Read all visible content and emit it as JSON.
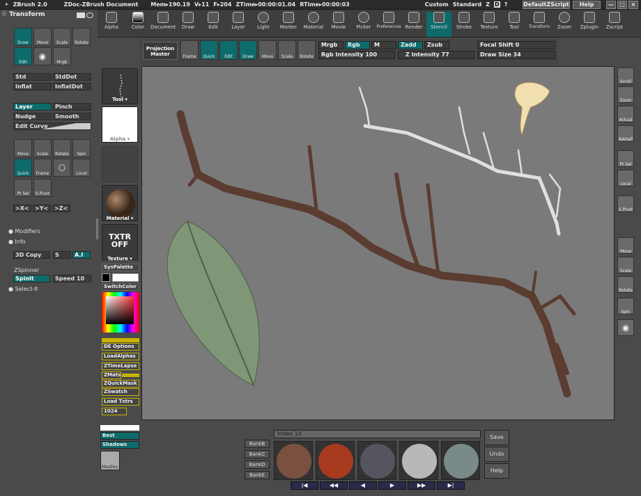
{
  "titlebar": {
    "app": "ZBrush 2.0",
    "doc": "ZDoc-ZBrush Document",
    "mem": "Mem▸190.19",
    "v": "V▸11",
    "f": "F▸204",
    "ztime": "ZTime▸00:00:01.04",
    "rtime": "RTime▸00:00:03",
    "custom": "Custom",
    "standard": "Standard",
    "z": "Z",
    "d": "D",
    "q": "?",
    "zscript": "DefaultZScript",
    "help": "Help"
  },
  "menu": [
    "Alpha",
    "Color",
    "Document",
    "Draw",
    "Edit",
    "Layer",
    "Light",
    "Marker",
    "Material",
    "Movie",
    "Picker",
    "Preferences",
    "Render",
    "Stencil",
    "Stroke",
    "Texture",
    "Tool",
    "Transform",
    "Zoom",
    "Zplugin",
    "Zscript"
  ],
  "left": {
    "title": "Transform",
    "icons1": [
      "Draw",
      "Move",
      "Scale",
      "Rotate"
    ],
    "icons2": [
      "Edit",
      "Snapshot",
      "Mrgb"
    ],
    "brushes": [
      "Std",
      "StdDot",
      "Inflat",
      "InflatDot"
    ],
    "brushes2": [
      "Layer",
      "Pinch",
      "Nudge",
      "Smooth"
    ],
    "editcurve": "Edit Curve",
    "deform": [
      "Move",
      "Scale",
      "Rotate",
      "Spin"
    ],
    "deform2": [
      "Quick",
      "Frame",
      "Solid",
      "Local"
    ],
    "deform3": [
      "Pt Sel",
      "S.Pivot"
    ],
    "axes": [
      ">X<",
      ">Y<",
      ">Z<"
    ],
    "modifiers": "Modifiers",
    "info": "Info",
    "copy3d": "3D Copy",
    "s": "S",
    "ai": "A.I",
    "zspinner": "ZSpinner",
    "spinit": "SpinIt",
    "speed": "Speed",
    "speedval": "10",
    "selectit": "Select-It"
  },
  "dock": {
    "tool": "Tool",
    "alpha": "Alpha",
    "material": "Material",
    "txtr": "TXTR OFF",
    "texture": "Texture",
    "syspalette": "SysPalette",
    "switchcolor": "SwitchColor",
    "buttons": [
      "DE Options",
      "LoadAlphas",
      "ZTimeLapse",
      "ZMats",
      "ZQuickMask",
      "ZSwatch",
      "Load Txtrs",
      "1024"
    ],
    "best": "Best",
    "shadows": "Shadows",
    "maxdoc": "MaxDoc"
  },
  "subtool": {
    "projection": "Projection Master",
    "modes": [
      "Frame",
      "Quick",
      "Edit",
      "Draw",
      "Move",
      "Scale",
      "Rotate"
    ],
    "mrgb": "Mrgb",
    "rgb": "Rgb",
    "m": "M",
    "zadd": "Zadd",
    "zsub": "Zsub",
    "rgbint": "Rgb Intensity",
    "rgbintval": "100",
    "zint": "Z Intensity",
    "zintval": "77",
    "focal": "Focal Shift",
    "focalval": "0",
    "drawsize": "Draw Size",
    "drawsizeval": "34"
  },
  "right": [
    "Scroll",
    "Zoom",
    "Actual",
    "AAHalf",
    "Pt Sel",
    "Local",
    "S.Pivot",
    "Move",
    "Scale",
    "Rotate",
    "Spin",
    "Snap"
  ],
  "bottom": {
    "index": "Index 14",
    "banks": [
      "BankB",
      "BankC",
      "BankD",
      "BankE"
    ],
    "save": "Save",
    "undo": "Undo",
    "help": "Help"
  },
  "colors": {
    "accent": "#0d6b6b",
    "yellow": "#c8b400"
  }
}
